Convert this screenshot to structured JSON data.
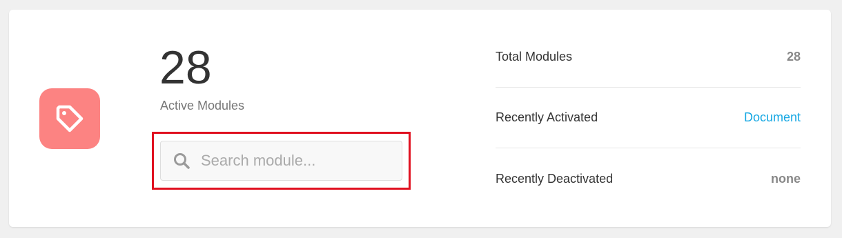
{
  "summary": {
    "count": "28",
    "label": "Active Modules"
  },
  "logo": {
    "icon": "tag-icon",
    "color": "#fc8382"
  },
  "search": {
    "placeholder": "Search module...",
    "value": ""
  },
  "stats": [
    {
      "label": "Total Modules",
      "value": "28",
      "type": "text"
    },
    {
      "label": "Recently Activated",
      "value": "Document",
      "type": "link"
    },
    {
      "label": "Recently Deactivated",
      "value": "none",
      "type": "text"
    }
  ],
  "colors": {
    "accent_link": "#17a8e3",
    "highlight_frame": "#e0101f"
  }
}
